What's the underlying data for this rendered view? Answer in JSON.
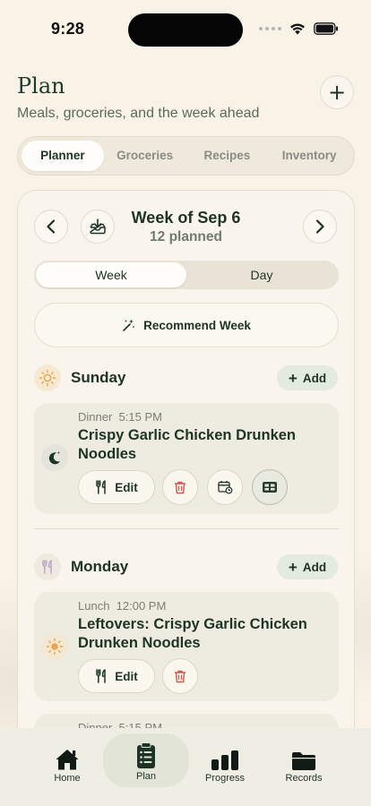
{
  "status_bar": {
    "time": "9:28"
  },
  "header": {
    "title": "Plan",
    "subtitle": "Meals, groceries, and the week ahead",
    "add_label": "+"
  },
  "tabs": [
    {
      "label": "Planner",
      "active": true
    },
    {
      "label": "Groceries",
      "active": false
    },
    {
      "label": "Recipes",
      "active": false
    },
    {
      "label": "Inventory",
      "active": false
    }
  ],
  "week": {
    "title": "Week of Sep 6",
    "count": "12 planned",
    "toggle": [
      "Week",
      "Day"
    ],
    "selected_toggle": "Week",
    "recommend_label": "Recommend Week"
  },
  "days": [
    {
      "name": "Sunday",
      "icon": "sun-icon",
      "add_label": "Add",
      "meals": [
        {
          "type": "Dinner",
          "time": "5:15 PM",
          "name": "Crispy Garlic Chicken Drunken Noodles",
          "icon": "moon-stars-icon",
          "edit_label": "Edit"
        }
      ]
    },
    {
      "name": "Monday",
      "icon": "fork-knife-icon",
      "add_label": "Add",
      "meals": [
        {
          "type": "Lunch",
          "time": "12:00 PM",
          "name": "Leftovers: Crispy Garlic Chicken Drunken Noodles",
          "icon": "sun-icon",
          "edit_label": "Edit"
        },
        {
          "type": "Dinner",
          "time": "5:15 PM"
        }
      ]
    }
  ],
  "tab_bar": [
    {
      "label": "Home",
      "icon": "house-icon",
      "active": false
    },
    {
      "label": "Plan",
      "icon": "clipboard-list-icon",
      "active": true
    },
    {
      "label": "Progress",
      "icon": "bar-chart-icon",
      "active": false
    },
    {
      "label": "Records",
      "icon": "folder-icon",
      "active": false
    }
  ],
  "colors": {
    "background": "#f8f2e7",
    "accent_dark": "#1d3325",
    "add_pill": "#e3ebdf",
    "delete_red": "#d0574d",
    "sun_orange": "#e9a74a"
  }
}
